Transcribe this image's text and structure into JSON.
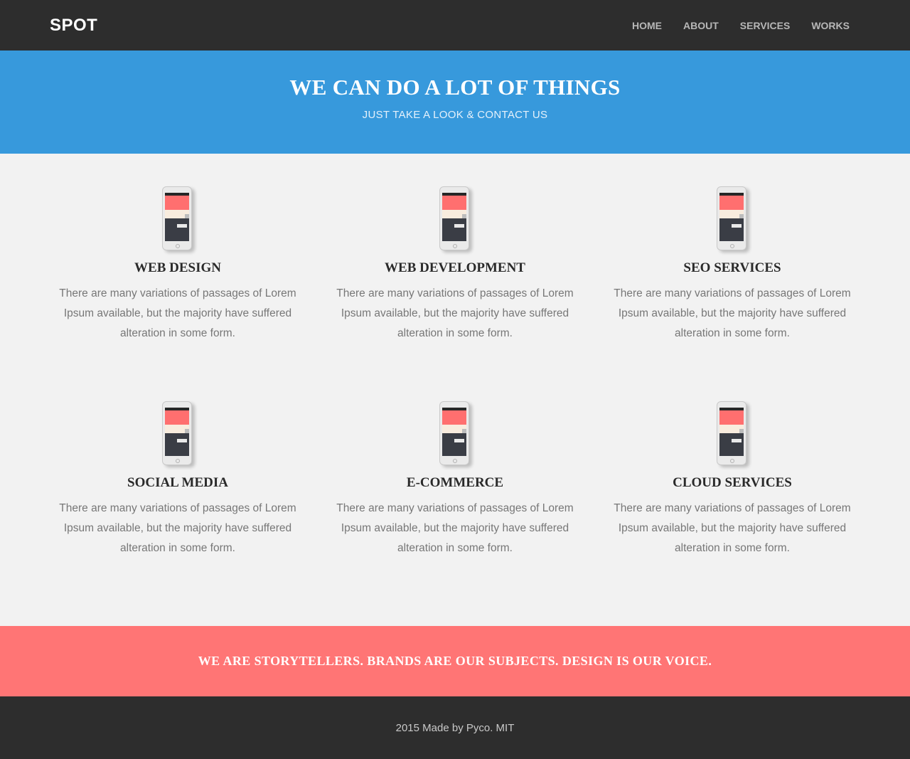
{
  "header": {
    "logo": "SPOT",
    "nav": [
      {
        "label": "HOME"
      },
      {
        "label": "ABOUT"
      },
      {
        "label": "SERVICES"
      },
      {
        "label": "WORKS"
      }
    ]
  },
  "hero": {
    "title": "WE CAN DO A LOT OF THINGS",
    "subtitle": "JUST TAKE A LOOK & CONTACT US"
  },
  "services": [
    {
      "title": "WEB DESIGN",
      "description": "There are many variations of passages of Lorem Ipsum available, but the majority have suffered alteration in some form.",
      "icon": "phone-icon"
    },
    {
      "title": "WEB DEVELOPMENT",
      "description": "There are many variations of passages of Lorem Ipsum available, but the majority have suffered alteration in some form.",
      "icon": "phone-icon"
    },
    {
      "title": "SEO SERVICES",
      "description": "There are many variations of passages of Lorem Ipsum available, but the majority have suffered alteration in some form.",
      "icon": "phone-icon"
    },
    {
      "title": "SOCIAL MEDIA",
      "description": "There are many variations of passages of Lorem Ipsum available, but the majority have suffered alteration in some form.",
      "icon": "phone-icon"
    },
    {
      "title": "E-COMMERCE",
      "description": "There are many variations of passages of Lorem Ipsum available, but the majority have suffered alteration in some form.",
      "icon": "phone-icon"
    },
    {
      "title": "CLOUD SERVICES",
      "description": "There are many variations of passages of Lorem Ipsum available, but the majority have suffered alteration in some form.",
      "icon": "phone-icon"
    }
  ],
  "banner": {
    "text": "WE ARE STORYTELLERS. BRANDS ARE OUR SUBJECTS. DESIGN IS OUR VOICE."
  },
  "footer": {
    "text": "2015 Made by Pyco. MIT"
  },
  "colors": {
    "header_bg": "#2d2d2d",
    "hero_bg": "#3799dc",
    "content_bg": "#f2f2f2",
    "banner_bg": "#ff7575",
    "footer_bg": "#2d2d2d"
  }
}
